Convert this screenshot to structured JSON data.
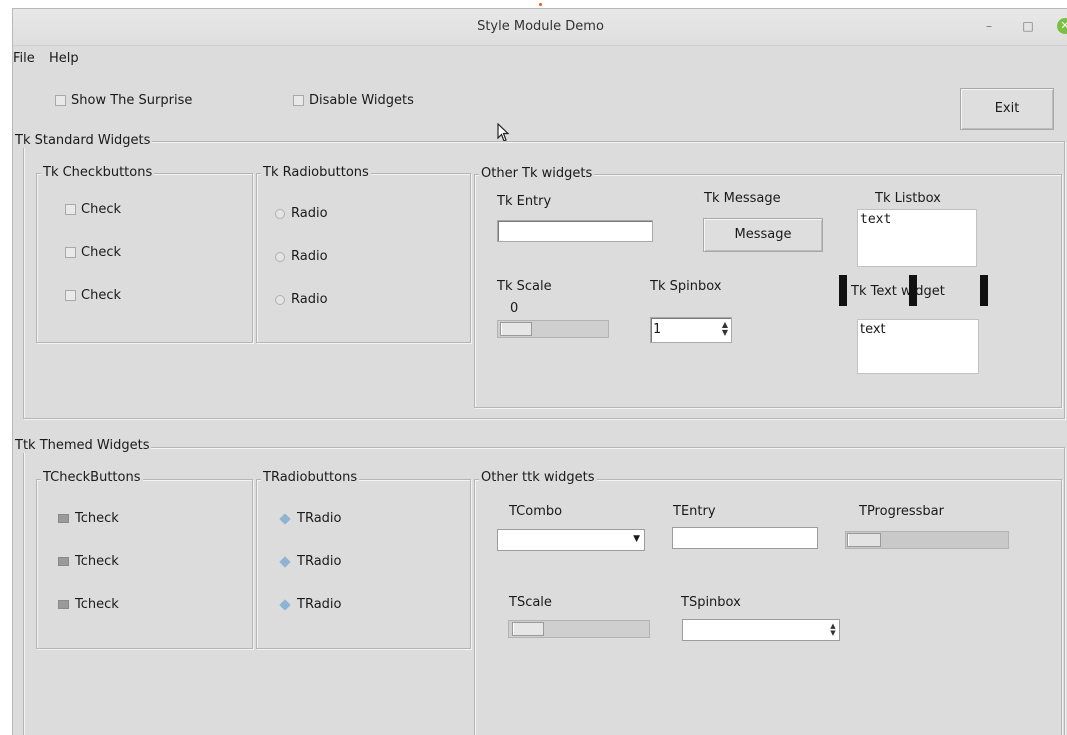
{
  "window": {
    "title": "Style Module Demo",
    "minimize": "–",
    "maximize": "□",
    "close": "✕"
  },
  "menu": {
    "file": "File",
    "help": "Help"
  },
  "top": {
    "show_surprise": "Show The Surprise",
    "disable_widgets": "Disable Widgets",
    "exit": "Exit"
  },
  "tk": {
    "title": "Tk Standard Widgets",
    "checkbuttons": {
      "title": "Tk Checkbuttons",
      "items": [
        "Check",
        "Check",
        "Check"
      ]
    },
    "radiobuttons": {
      "title": "Tk Radiobuttons",
      "items": [
        "Radio",
        "Radio",
        "Radio"
      ]
    },
    "other": {
      "title": "Other Tk widgets",
      "entry_label": "Tk Entry",
      "entry_value": "",
      "message_label": "Tk Message",
      "message_button": "Message",
      "listbox_label": "Tk Listbox",
      "listbox_items": [
        "text"
      ],
      "scale_label": "Tk Scale",
      "scale_value": "0",
      "spinbox_label": "Tk Spinbox",
      "spinbox_value": "1",
      "text_label": "Tk Text widget",
      "text_content": "text"
    }
  },
  "ttk": {
    "title": "Ttk Themed Widgets",
    "checkbuttons": {
      "title": "TCheckButtons",
      "items": [
        "Tcheck",
        "Tcheck",
        "Tcheck"
      ]
    },
    "radiobuttons": {
      "title": "TRadiobuttons",
      "items": [
        "TRadio",
        "TRadio",
        "TRadio"
      ]
    },
    "other": {
      "title": "Other ttk widgets",
      "combo_label": "TCombo",
      "combo_value": "",
      "entry_label": "TEntry",
      "entry_value": "",
      "progress_label": "TProgressbar",
      "progress_value": 0.2,
      "scale_label": "TScale",
      "scale_value": 0.2,
      "spinbox_label": "TSpinbox",
      "spinbox_value": ""
    }
  }
}
